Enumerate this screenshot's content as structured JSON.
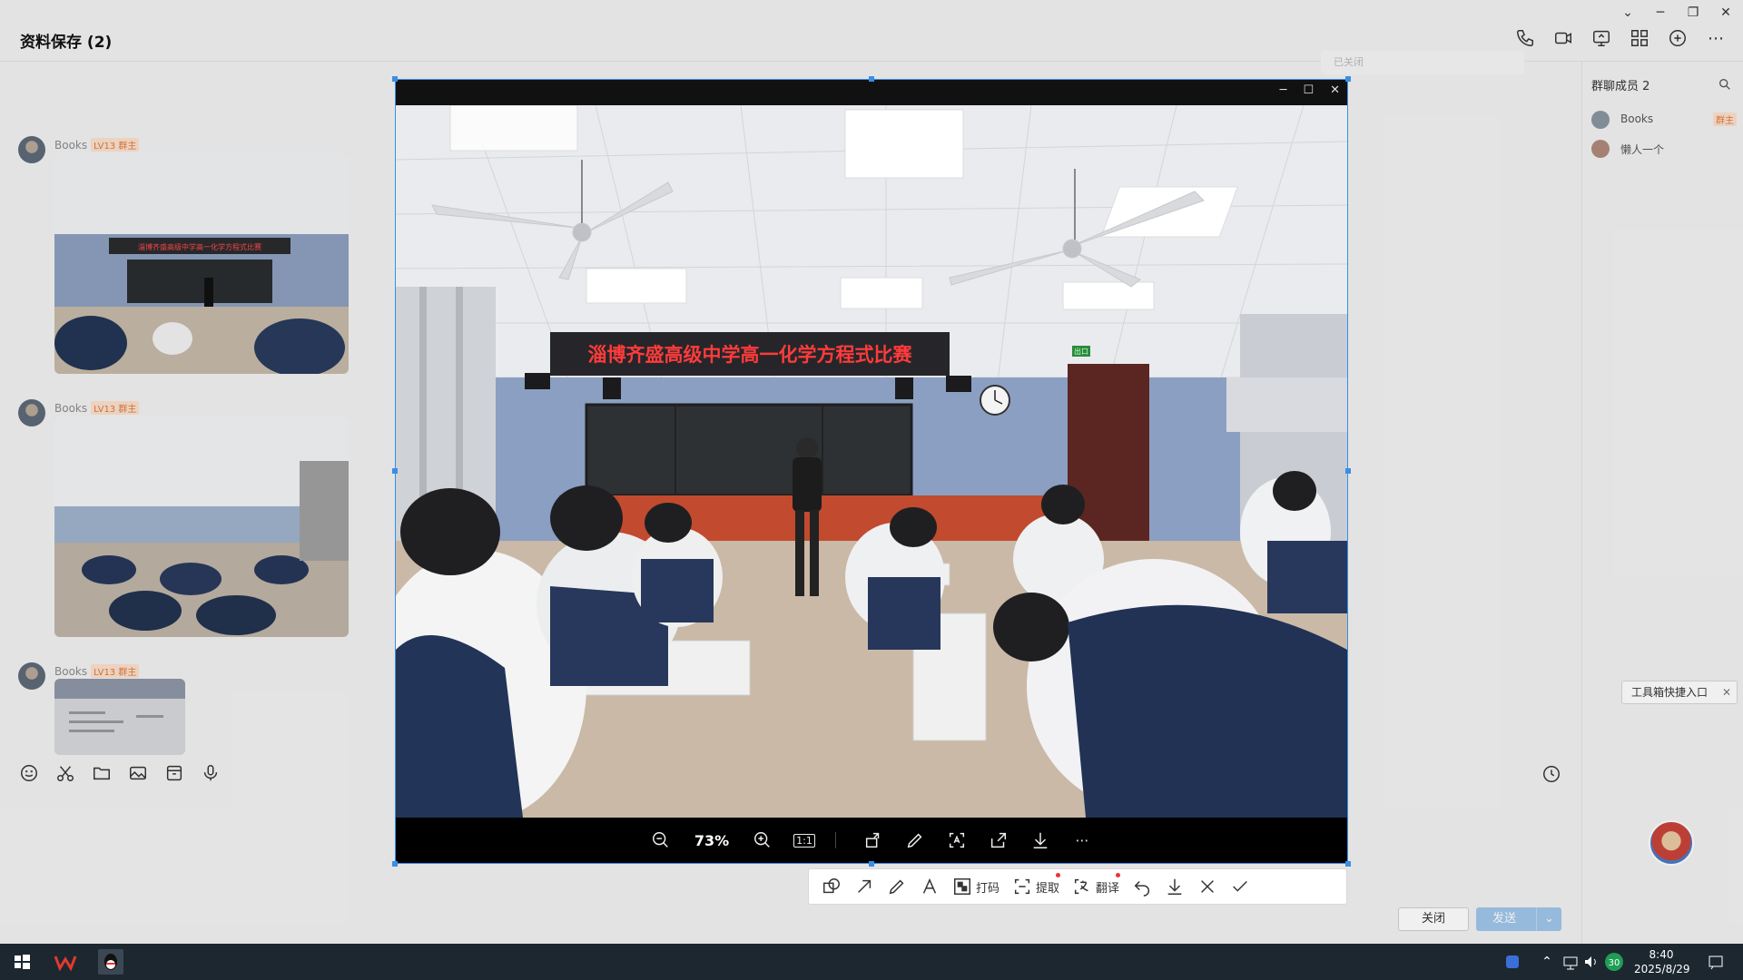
{
  "chat": {
    "title": "资料保存 (2)",
    "messages": [
      {
        "sender": "Books",
        "level": "LV13 群主"
      },
      {
        "sender": "Books",
        "level": "LV13 群主"
      },
      {
        "sender": "Books",
        "level": "LV13 群主"
      }
    ],
    "thumb_banner": "淄博齐盛高级中学高一化学方程式比赛",
    "send_label": "发送",
    "close_label": "关闭",
    "search_placeholder": "已关闭"
  },
  "members": {
    "title": "群聊成员 2",
    "list": [
      {
        "name": "Books",
        "role": "群主"
      },
      {
        "name": "懒人一个",
        "role": ""
      }
    ]
  },
  "tooltip": {
    "text": "工具箱快捷入口"
  },
  "viewer": {
    "zoom": "73%",
    "one_to_one": "1:1",
    "photo": {
      "banner_text": "淄博齐盛高级中学高一化学方程式比赛",
      "exit_sign": "出口"
    }
  },
  "snapbar": {
    "mosaic_label": "打码",
    "extract_label": "提取",
    "translate_label": "翻译"
  },
  "taskbar": {
    "time": "8:40",
    "date": "2025/8/29",
    "badge": "30"
  },
  "colors": {
    "accent": "#3a8ee6",
    "led_red": "#ff3b3b",
    "wall_blue": "#8a9fc2"
  }
}
